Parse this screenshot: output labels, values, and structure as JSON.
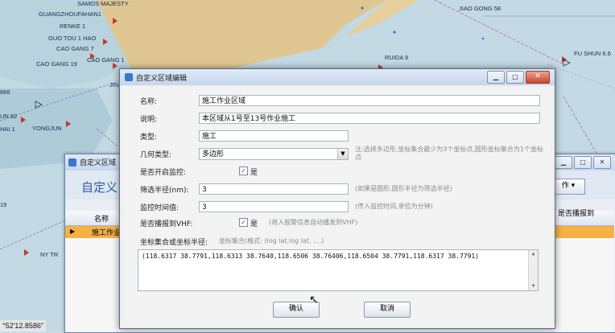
{
  "map": {
    "ship_labels": [
      "SAMOS MAJESTY",
      "GUANGZHOUFAHAN1",
      "RENKE 1",
      "GUO TOU 1 HAO",
      "CAO GANG 7",
      "CAO GANG 19",
      "CAO GANG 1",
      "JIAO GONG 58",
      "FU SHUN 6.6",
      "RUIDA 9",
      "YONGJUN",
      "UN 82",
      "HAI 1",
      "666",
      "19",
      "NY TR",
      "JIN"
    ],
    "coordinate_readout": "°52'12.8586\""
  },
  "back_window": {
    "title": "自定义区域",
    "header_title": "自定义",
    "op_button": "作",
    "grid_header_name": "名称",
    "grid_header_right": "是否播报到",
    "row_name": "施工作业"
  },
  "dialog": {
    "title": "自定义区域编辑",
    "close_glyph": "✕",
    "min_glyph": "▁",
    "max_glyph": "□",
    "fields": {
      "name_label": "名称:",
      "name_value": "施工作业区域",
      "desc_label": "说明:",
      "desc_value": "本区域从1号至13号作业施工",
      "type_label": "类型:",
      "type_value": "施工",
      "geometry_label": "几何类型:",
      "geometry_value": "多边形",
      "geometry_hint": "注:选择多边形,坐标集合最少为3个坐标点,圆形坐标集合为1个坐标点",
      "monitor_label": "是否开启监控:",
      "monitor_check": "是",
      "radius_label": "筛选半径(nm):",
      "radius_value": "3",
      "radius_hint": "(如果是圆形,圆形半径为筛选半径)",
      "threshold_label": "监控时间值:",
      "threshold_value": "3",
      "threshold_hint": "(传入监控时间,单位为分钟)",
      "vhf_label": "是否播报到VHF:",
      "vhf_check": "是",
      "vhf_hint": "(将入报警信息自动播发到VHF)",
      "coords_label": "坐标集合或坐标半径:",
      "coords_hint": "坐标集合(格式: (log lat,log lat, ....)",
      "coords_value": "(118.6317 38.7791,118.6313 38.7640,118.6506 38.76406,118.6504 38.7791,118.6317 38.7791)"
    },
    "ok_label": "确认",
    "cancel_label": "取消"
  }
}
